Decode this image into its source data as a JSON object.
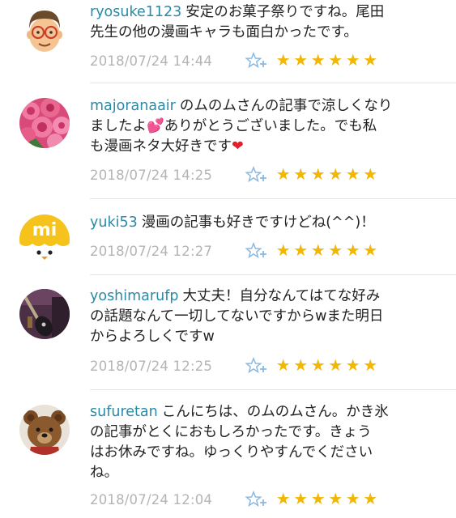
{
  "comments": [
    {
      "username": "ryosuke1123",
      "text": "安定のお菓子祭りですね。尾田\n先生の他の漫画キャラも面白かったです。",
      "timestamp": "2018/07/24 14:44",
      "stars": [
        "★",
        "★",
        "★",
        "★",
        "★",
        "★"
      ],
      "avatar_icon": "cartoon-man-with-glasses-icon"
    },
    {
      "username": "majoranaair",
      "text_part1": "のムのムさんの記事で涼しくなり\nましたよ",
      "emoji_hearts": "💕",
      "text_part2": "ありがとうございました。でも私\nも漫画ネタ大好きです",
      "emoji_heart": "❤",
      "timestamp": "2018/07/24 14:25",
      "stars": [
        "★",
        "★",
        "★",
        "★",
        "★",
        "★"
      ],
      "avatar_icon": "pink-roses-icon"
    },
    {
      "username": "yuki53",
      "text": "漫画の記事も好きですけどね(^^)！",
      "timestamp": "2018/07/24 12:27",
      "stars": [
        "★",
        "★",
        "★",
        "★",
        "★",
        "★"
      ],
      "avatar_icon": "yellow-mi-chick-icon",
      "avatar_text": "mi"
    },
    {
      "username": "yoshimarufp",
      "text": "大丈夫！自分なんてはてな好み\nの話題なんて一切してないですからwまた明日\nからよろしくですw",
      "timestamp": "2018/07/24 12:25",
      "stars": [
        "★",
        "★",
        "★",
        "★",
        "★",
        "★"
      ],
      "avatar_icon": "guitar-photo-icon"
    },
    {
      "username": "sufuretan",
      "text": "こんにちは、のムのムさん。かき氷\nの記事がとくにおもしろかったです。きょう\nはお休みですね。ゆっくりやすんでください\nね。",
      "timestamp": "2018/07/24 12:04",
      "stars": [
        "★",
        "★",
        "★",
        "★",
        "★",
        "★"
      ],
      "avatar_icon": "teddy-bear-icon"
    }
  ],
  "add_star_icon": "add-star-icon",
  "colors": {
    "username": "#2a8aa8",
    "timestamp": "#b4b4b4",
    "star": "#f2b705",
    "add_star": "#8ab8e0",
    "divider": "#e4e4e4"
  }
}
